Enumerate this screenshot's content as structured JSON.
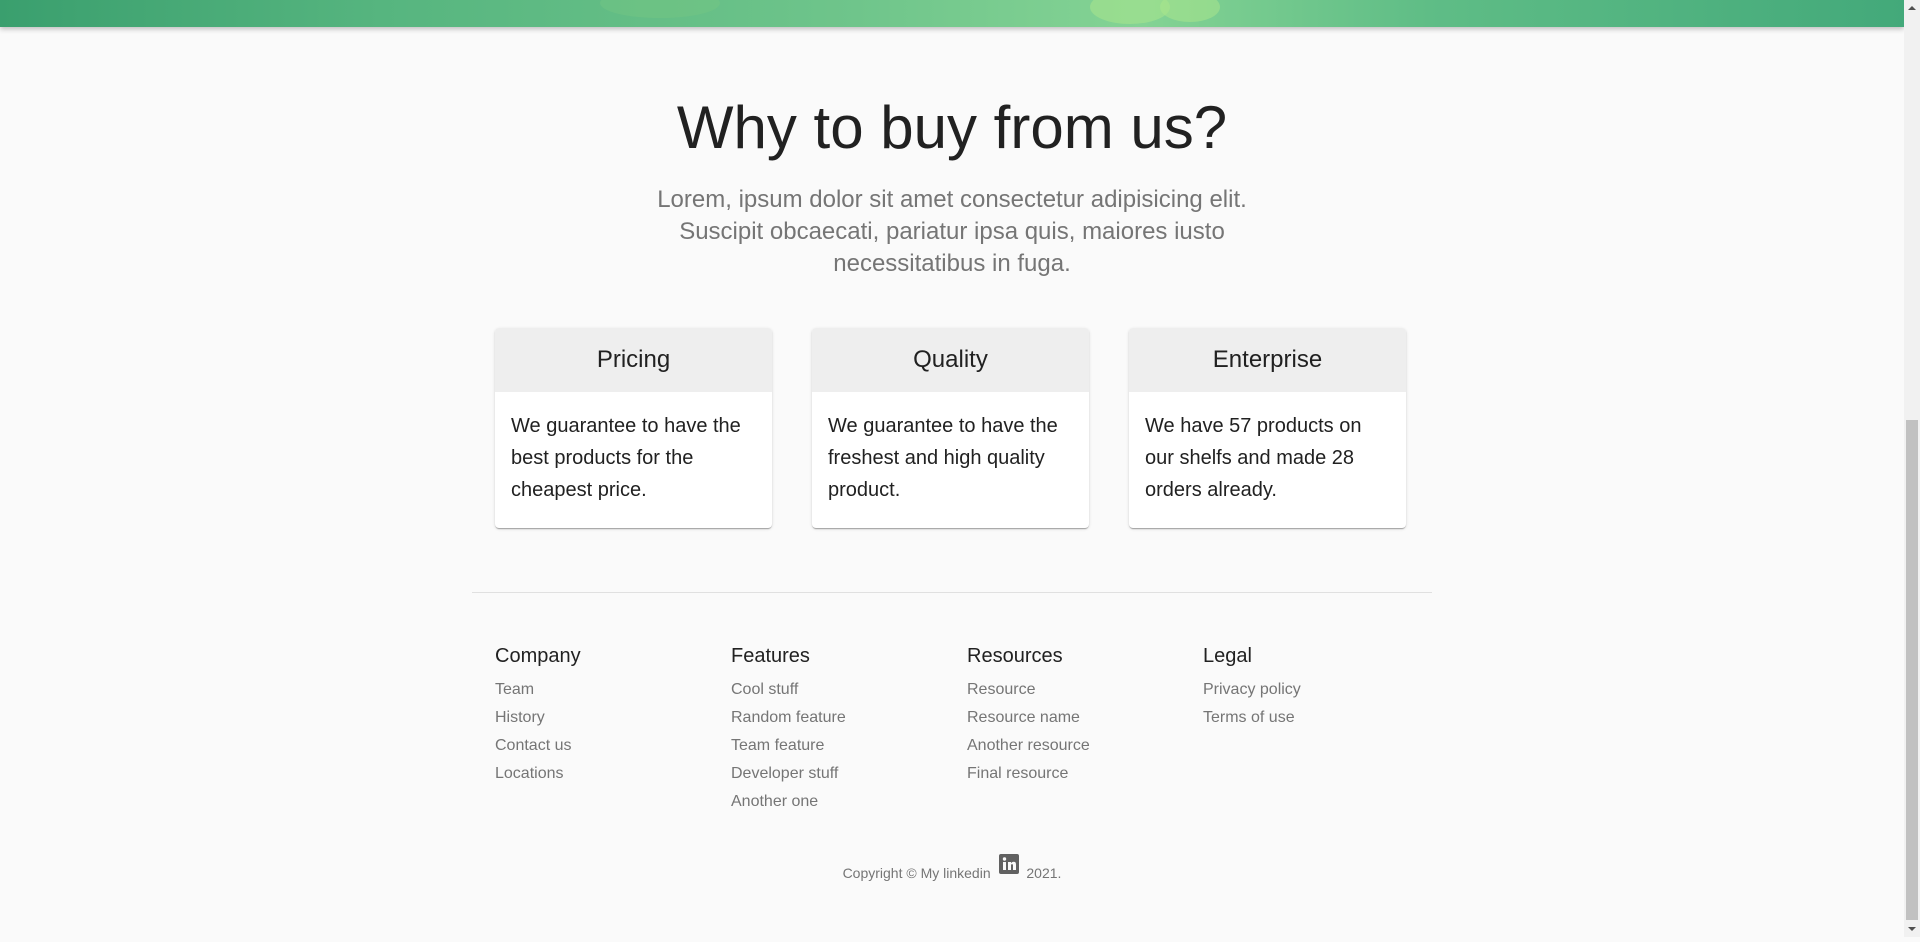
{
  "why": {
    "title": "Why to buy from us?",
    "subtitle": "Lorem, ipsum dolor sit amet consectetur adipisicing elit. Suscipit obcaecati, pariatur ipsa quis, maiores iusto necessitatibus in fuga."
  },
  "cards": [
    {
      "title": "Pricing",
      "text": "We guarantee to have the best products for the cheapest price."
    },
    {
      "title": "Quality",
      "text": "We guarantee to have the freshest and high quality product."
    },
    {
      "title": "Enterprise",
      "text": "We have 57 products on our shelfs and made 28 orders already."
    }
  ],
  "footer": {
    "columns": [
      {
        "title": "Company",
        "links": [
          "Team",
          "History",
          "Contact us",
          "Locations"
        ]
      },
      {
        "title": "Features",
        "links": [
          "Cool stuff",
          "Random feature",
          "Team feature",
          "Developer stuff",
          "Another one"
        ]
      },
      {
        "title": "Resources",
        "links": [
          "Resource",
          "Resource name",
          "Another resource",
          "Final resource"
        ]
      },
      {
        "title": "Legal",
        "links": [
          "Privacy policy",
          "Terms of use"
        ]
      }
    ],
    "copyright_prefix": "Copyright © My linkedin",
    "copyright_year": "2021.",
    "linkedin_icon": "linkedin-icon"
  },
  "colors": {
    "background": "#fafafa",
    "card_header": "#eeeeee",
    "heading_text": "#212121",
    "muted_text": "#757575",
    "hero_green": "#56b57f"
  }
}
